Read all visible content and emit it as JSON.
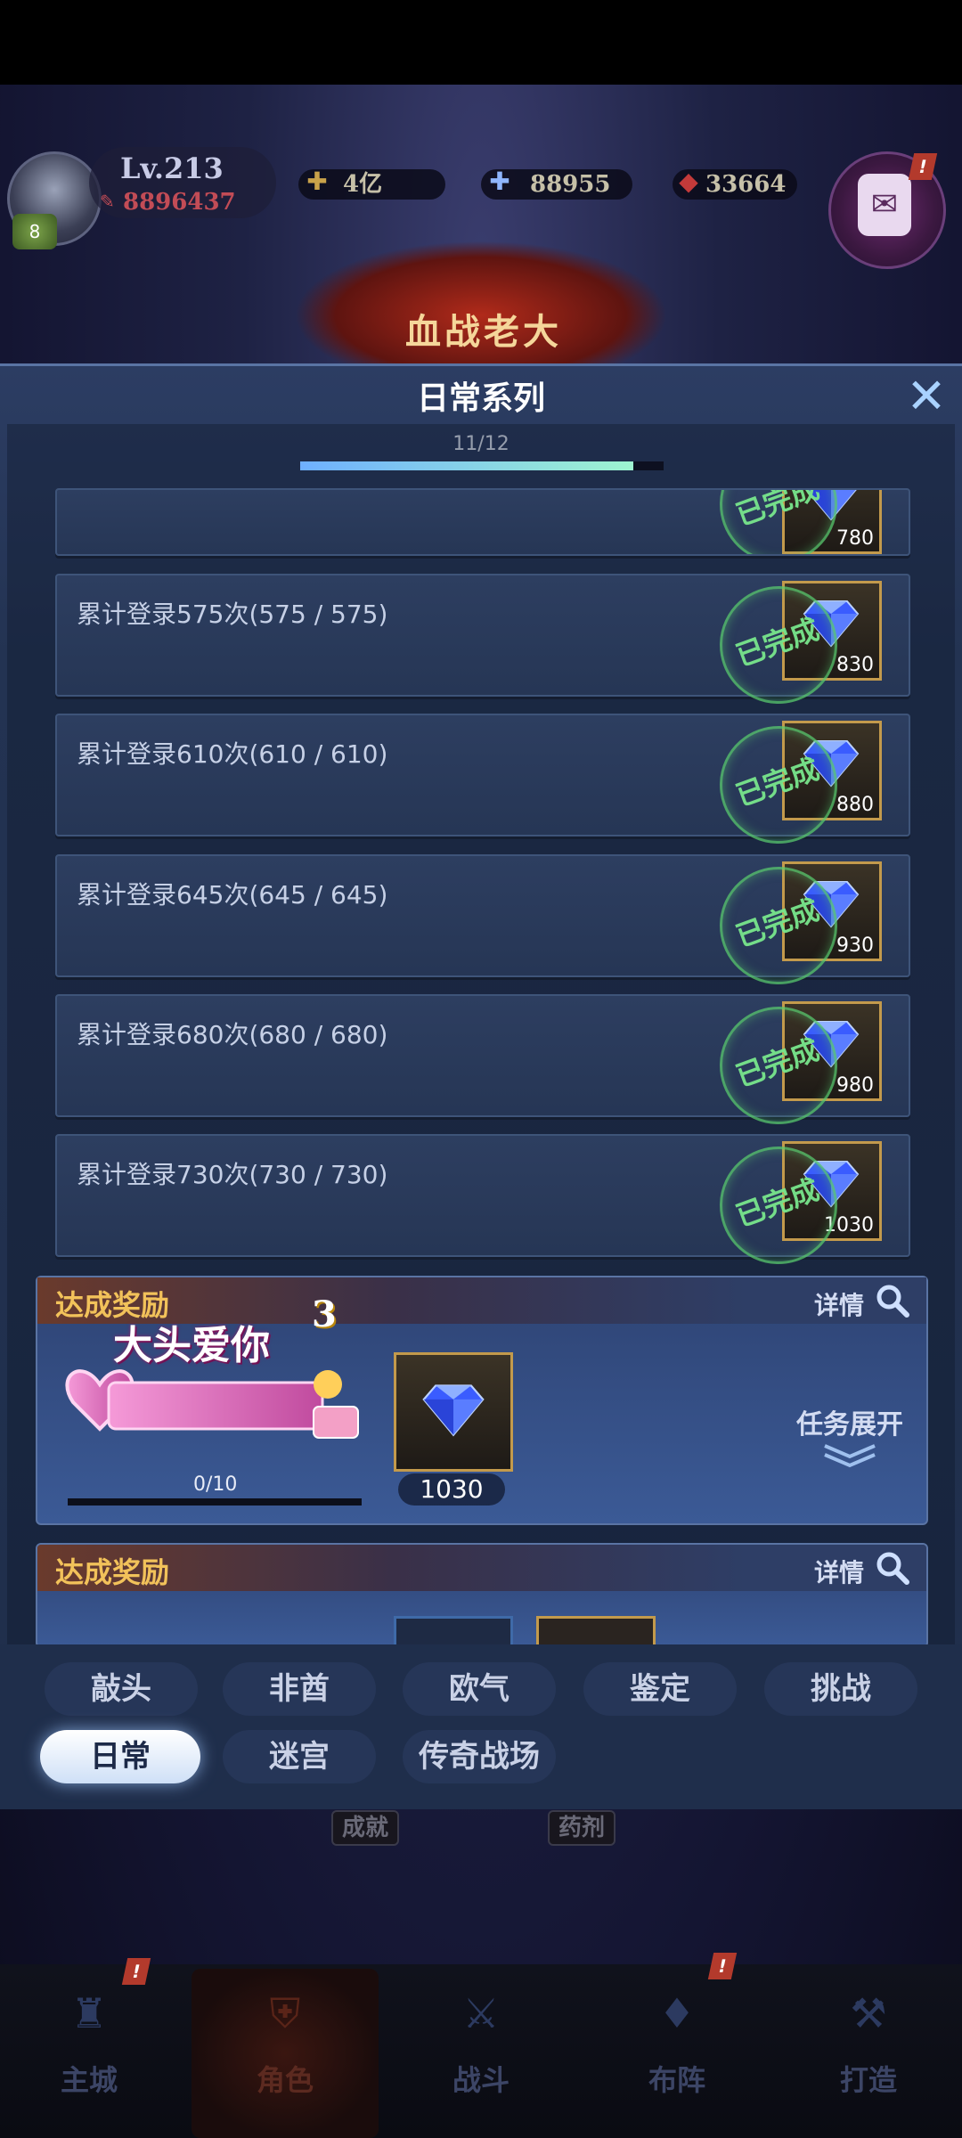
{
  "hud": {
    "level": "Lv.213",
    "power": "8896437",
    "avatar_badge": "8",
    "gold": "4亿",
    "diamonds": "88955",
    "gems": "33664",
    "alert_mark": "!"
  },
  "banner": {
    "boss_name": "血战老大"
  },
  "modal": {
    "title": "日常系列",
    "progress_text": "11/12",
    "progress_fraction": 0.9167,
    "close_symbol": "✕"
  },
  "tasks": [
    {
      "label": "",
      "reward": "780",
      "status": "已完成"
    },
    {
      "label": "累计登录575次(575 / 575)",
      "reward": "830",
      "status": "已完成"
    },
    {
      "label": "累计登录610次(610 / 610)",
      "reward": "880",
      "status": "已完成"
    },
    {
      "label": "累计登录645次(645 / 645)",
      "reward": "930",
      "status": "已完成"
    },
    {
      "label": "累计登录680次(680 / 680)",
      "reward": "980",
      "status": "已完成"
    },
    {
      "label": "累计登录730次(730 / 730)",
      "reward": "1030",
      "status": "已完成"
    }
  ],
  "achievements": [
    {
      "title": "达成奖励",
      "detail": "详情",
      "badge_text": "大头爱你",
      "badge_num": "3",
      "progress": "0/10",
      "reward": "1030",
      "expand": "任务展开"
    },
    {
      "title": "达成奖励",
      "detail": "详情"
    }
  ],
  "tabs": {
    "row1": [
      "敲头",
      "非酋",
      "欧气",
      "鉴定",
      "挑战"
    ],
    "row2": [
      "日常",
      "迷宫",
      "传奇战场"
    ],
    "active": "日常"
  },
  "sub_buttons": [
    "成就",
    "药剂"
  ],
  "bottom_nav": [
    "主城",
    "角色",
    "战斗",
    "布阵",
    "打造"
  ],
  "colors": {
    "accent_gold": "#c39a4c",
    "done_green": "#58c86e",
    "title_gold": "#f2c25a"
  }
}
